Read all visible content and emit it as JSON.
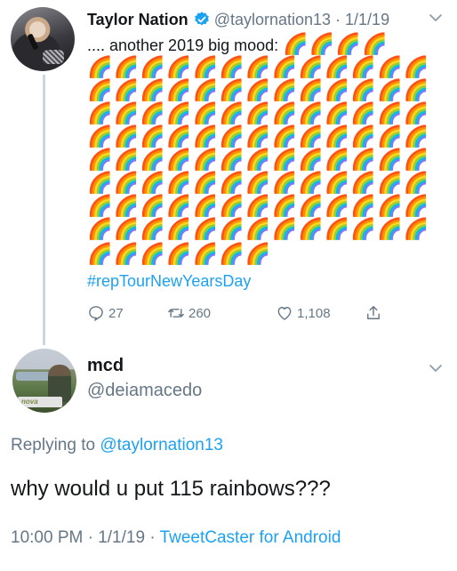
{
  "tweet1": {
    "display_name": "Taylor Nation",
    "handle_time": "@taylornation13 · 1/1/19",
    "text": ".... another 2019 big mood: ",
    "inline_rainbows": "🌈🌈🌈🌈",
    "rainbow_rows": [
      "🌈🌈🌈🌈🌈🌈🌈🌈🌈🌈🌈🌈🌈",
      "🌈🌈🌈🌈🌈🌈🌈🌈🌈🌈🌈🌈🌈",
      "🌈🌈🌈🌈🌈🌈🌈🌈🌈🌈🌈🌈🌈",
      "🌈🌈🌈🌈🌈🌈🌈🌈🌈🌈🌈🌈🌈",
      "🌈🌈🌈🌈🌈🌈🌈🌈🌈🌈🌈🌈🌈",
      "🌈🌈🌈🌈🌈🌈🌈🌈🌈🌈🌈🌈🌈",
      "🌈🌈🌈🌈🌈🌈🌈🌈🌈🌈🌈🌈🌈",
      "🌈🌈🌈🌈🌈🌈🌈🌈🌈🌈🌈🌈🌈",
      "🌈🌈🌈🌈🌈🌈🌈"
    ],
    "hashtag": "#repTourNewYearsDay",
    "replies": "27",
    "retweets": "260",
    "likes": "1,108"
  },
  "tweet2": {
    "display_name": "mcd",
    "handle": "@deiamacedo",
    "avatar_badge": "nova",
    "replying_prefix": "Replying to ",
    "replying_handle": "@taylornation13",
    "text": "why would u put 115 rainbows???",
    "timestamp": "10:00 PM · 1/1/19 · ",
    "source": "TweetCaster for Android"
  },
  "colors": {
    "link": "#1da1f2",
    "secondary": "#657786",
    "primary": "#14171a",
    "verified": "#1da1f2",
    "thread_line": "#ccd6dd"
  },
  "icons": {
    "verified": "verified-badge-icon",
    "caret": "chevron-down-icon",
    "reply": "reply-icon",
    "retweet": "retweet-icon",
    "like": "heart-icon",
    "share": "share-icon"
  }
}
